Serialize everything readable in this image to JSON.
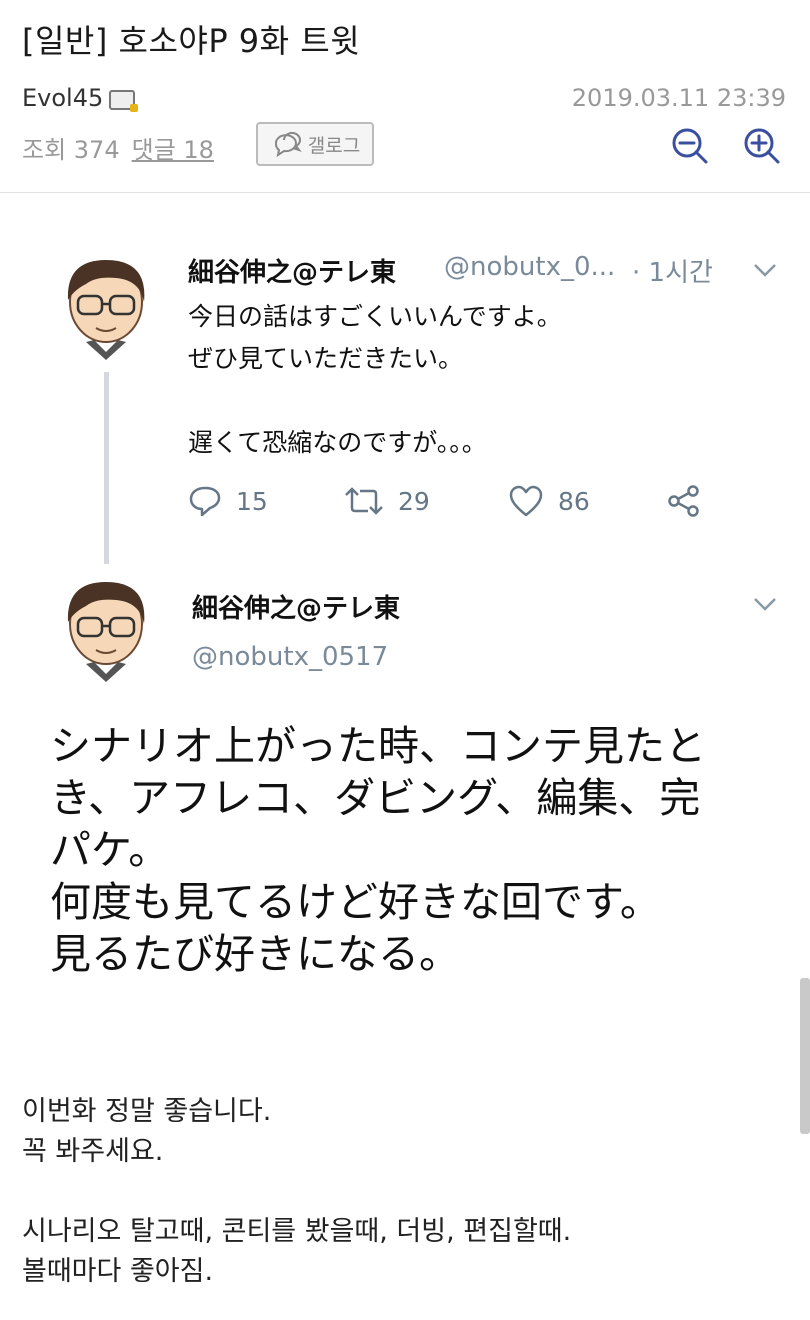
{
  "post": {
    "title": "[일반] 호소야P 9화 트윗",
    "author": "Evol45",
    "datetime": "2019.03.11 23:39",
    "views_label": "조회 374",
    "comments_label": "댓글 18",
    "gallog_label": "갤로그"
  },
  "tweet1": {
    "name": "細谷伸之@テレ東",
    "handle": "@nobutx_0...",
    "time": "· 1시간",
    "lines": [
      "今日の話はすごくいいんですよ。",
      "ぜひ見ていただきたい。",
      "",
      "遅くて恐縮なのですが。。。"
    ],
    "replies": "15",
    "retweets": "29",
    "likes": "86"
  },
  "tweet2": {
    "name": "細谷伸之@テレ東",
    "handle": "@nobutx_0517",
    "lines": [
      "シナリオ上がった時、コンテ見たと",
      "き、アフレコ、ダビング、編集、完",
      "パケ。",
      "何度も見てるけど好きな回です。",
      "見るたび好きになる。"
    ]
  },
  "body": {
    "lines": [
      "이번화 정말 좋습니다.",
      "꼭 봐주세요.",
      "",
      "시나리오 탈고때, 콘티를 봤을때, 더빙, 편집할때.",
      "볼때마다 좋아짐."
    ]
  },
  "colors": {
    "meta_gray": "#999999",
    "zoom_blue": "#3b4fa0",
    "twitter_gray": "#657786"
  },
  "icons": [
    "badge-icon",
    "gallog-chat-icon",
    "zoom-out-icon",
    "zoom-in-icon",
    "chevron-down-icon",
    "reply-icon",
    "retweet-icon",
    "like-icon",
    "share-icon"
  ]
}
